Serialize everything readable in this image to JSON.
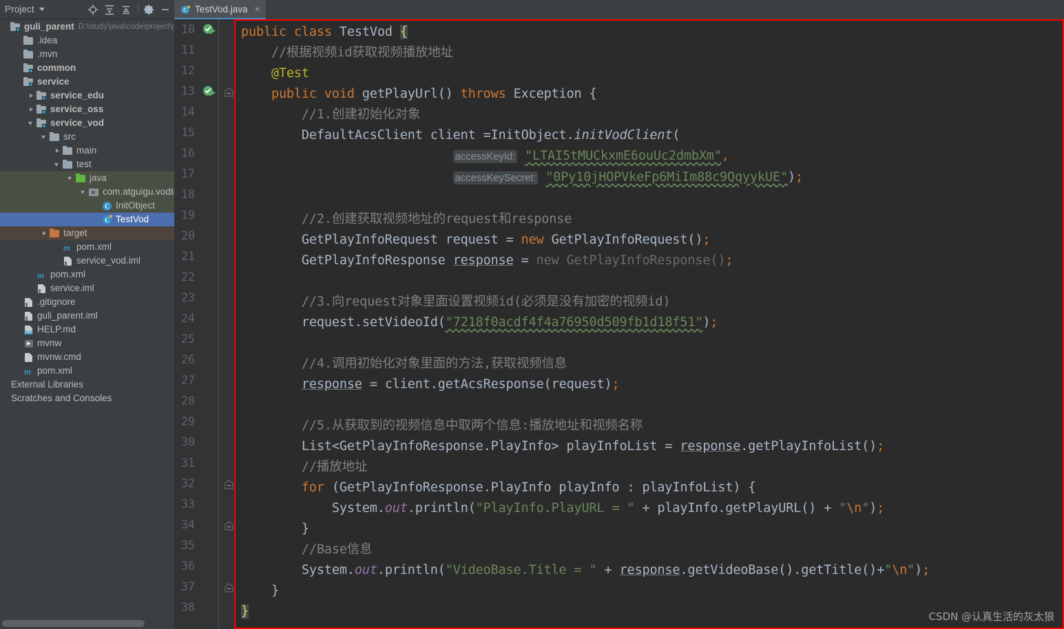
{
  "window": {
    "background": "#3c3f41",
    "editor_background": "#2b2b2b",
    "accent": "#4b6eaf",
    "highlight_border": "#ff0000"
  },
  "left_toolbar": {
    "title": "Project",
    "icons": [
      {
        "name": "locate-target-icon",
        "glyph": "locate"
      },
      {
        "name": "expand-all-icon",
        "glyph": "expand"
      },
      {
        "name": "collapse-all-icon",
        "glyph": "collapse"
      },
      {
        "name": "settings-gear-icon",
        "glyph": "gear"
      },
      {
        "name": "hide-panel-icon",
        "glyph": "minus"
      }
    ]
  },
  "tree": {
    "items": [
      {
        "label": "guli_parent",
        "path": "D:\\study\\java\\code\\project\\gu",
        "indent": 0,
        "arrow": "none",
        "icon": "module-icon",
        "bold": true,
        "state": "normal"
      },
      {
        "label": ".idea",
        "indent": 1,
        "arrow": "none",
        "icon": "folder-icon",
        "state": "normal"
      },
      {
        "label": ".mvn",
        "indent": 1,
        "arrow": "none",
        "icon": "folder-icon",
        "state": "normal"
      },
      {
        "label": "common",
        "indent": 1,
        "arrow": "none",
        "icon": "module-icon",
        "bold": true,
        "state": "normal"
      },
      {
        "label": "service",
        "indent": 1,
        "arrow": "none",
        "icon": "module-icon",
        "bold": true,
        "state": "normal"
      },
      {
        "label": "service_edu",
        "indent": 2,
        "arrow": "right",
        "icon": "module-icon",
        "bold": true,
        "state": "normal"
      },
      {
        "label": "service_oss",
        "indent": 2,
        "arrow": "right",
        "icon": "module-icon",
        "bold": true,
        "state": "normal"
      },
      {
        "label": "service_vod",
        "indent": 2,
        "arrow": "down",
        "icon": "module-icon",
        "bold": true,
        "state": "normal"
      },
      {
        "label": "src",
        "indent": 3,
        "arrow": "down",
        "icon": "folder-icon",
        "state": "normal"
      },
      {
        "label": "main",
        "indent": 4,
        "arrow": "right",
        "icon": "folder-icon",
        "state": "normal"
      },
      {
        "label": "test",
        "indent": 4,
        "arrow": "down",
        "icon": "folder-icon",
        "state": "normal"
      },
      {
        "label": "java",
        "indent": 5,
        "arrow": "down",
        "icon": "test-source-folder-icon",
        "state": "testsrc"
      },
      {
        "label": "com.atguigu.vodtest",
        "indent": 6,
        "arrow": "down",
        "icon": "package-icon",
        "state": "testsrc"
      },
      {
        "label": "InitObject",
        "indent": 7,
        "arrow": "none",
        "icon": "java-class-icon",
        "state": "testsrc"
      },
      {
        "label": "TestVod",
        "indent": 7,
        "arrow": "none",
        "icon": "java-test-class-icon",
        "state": "selected"
      },
      {
        "label": "target",
        "indent": 3,
        "arrow": "right",
        "icon": "excluded-folder-icon",
        "state": "target"
      },
      {
        "label": "pom.xml",
        "indent": 4,
        "arrow": "none",
        "icon": "maven-icon",
        "state": "normal"
      },
      {
        "label": "service_vod.iml",
        "indent": 4,
        "arrow": "none",
        "icon": "iml-file-icon",
        "state": "normal"
      },
      {
        "label": "pom.xml",
        "indent": 2,
        "arrow": "none",
        "icon": "maven-icon",
        "state": "normal"
      },
      {
        "label": "service.iml",
        "indent": 2,
        "arrow": "none",
        "icon": "iml-file-icon",
        "state": "normal"
      },
      {
        "label": ".gitignore",
        "indent": 1,
        "arrow": "none",
        "icon": "gitignore-file-icon",
        "state": "normal"
      },
      {
        "label": "guli_parent.iml",
        "indent": 1,
        "arrow": "none",
        "icon": "iml-file-icon",
        "state": "normal"
      },
      {
        "label": "HELP.md",
        "indent": 1,
        "arrow": "none",
        "icon": "markdown-file-icon",
        "state": "normal"
      },
      {
        "label": "mvnw",
        "indent": 1,
        "arrow": "none",
        "icon": "shell-script-icon",
        "state": "normal"
      },
      {
        "label": "mvnw.cmd",
        "indent": 1,
        "arrow": "none",
        "icon": "cmd-file-icon",
        "state": "normal"
      },
      {
        "label": "pom.xml",
        "indent": 1,
        "arrow": "none",
        "icon": "maven-icon",
        "state": "normal"
      },
      {
        "label": "External Libraries",
        "indent": 0,
        "arrow": "none",
        "icon": "library-icon",
        "state": "normal"
      },
      {
        "label": "Scratches and Consoles",
        "indent": 0,
        "arrow": "none",
        "icon": "scratches-icon",
        "state": "normal"
      }
    ]
  },
  "tabs": [
    {
      "label": "TestVod.java",
      "icon": "java-test-class-icon",
      "active": true,
      "close": "×"
    }
  ],
  "editor": {
    "first_line": 10,
    "last_line": 38,
    "line_numbers": [
      10,
      11,
      12,
      13,
      14,
      15,
      16,
      17,
      18,
      19,
      20,
      21,
      22,
      23,
      24,
      25,
      26,
      27,
      28,
      29,
      30,
      31,
      32,
      33,
      34,
      35,
      36,
      37,
      38
    ],
    "run_gutter_lines": [
      10,
      13
    ],
    "fold_gutter_lines": [
      13,
      32,
      34,
      37
    ],
    "hints": {
      "access_key_id": "accessKeyId:",
      "access_key_secret": "accessKeySecret:"
    },
    "values": {
      "class_name": "TestVod",
      "method_name": "getPlayUrl",
      "access_key_id": "LTAI5tMUCkxmE6ouUc2dmbXm",
      "access_key_secret": "0Py10jHOPVkeFp6MiIm88c9QqyykUE",
      "video_id": "7218f0acdf4f4a76950d509fb1d18f51",
      "print_playurl": "PlayInfo.PlayURL = ",
      "print_title": "VideoBase.Title = ",
      "newline": "\\n"
    },
    "comments": {
      "c0": "//根据视频id获取视频播放地址",
      "c1": "//1.创建初始化对象",
      "c2": "//2.创建获取视频地址的request和response",
      "c3": "//3.向request对象里面设置视频id(必须是没有加密的视频id)",
      "c4": "//4.调用初始化对象里面的方法,获取视频信息",
      "c5": "//5.从获取到的视频信息中取两个信息:播放地址和视频名称",
      "c6": "//播放地址",
      "c7": "//Base信息"
    },
    "code_lines": [
      "public class TestVod {",
      "    //根据视频id获取视频播放地址",
      "    @Test",
      "    public void getPlayUrl() throws Exception {",
      "        //1.创建初始化对象",
      "        DefaultAcsClient client =InitObject.initVodClient(",
      "                            accessKeyId: \"LTAI5tMUCkxmE6ouUc2dmbXm\",",
      "                            accessKeySecret: \"0Py10jHOPVkeFp6MiIm88c9QqyykUE\");",
      "",
      "        //2.创建获取视频地址的request和response",
      "        GetPlayInfoRequest request = new GetPlayInfoRequest();",
      "        GetPlayInfoResponse response = new GetPlayInfoResponse();",
      "",
      "        //3.向request对象里面设置视频id(必须是没有加密的视频id)",
      "        request.setVideoId(\"7218f0acdf4f4a76950d509fb1d18f51\");",
      "",
      "        //4.调用初始化对象里面的方法,获取视频信息",
      "        response = client.getAcsResponse(request);",
      "",
      "        //5.从获取到的视频信息中取两个信息:播放地址和视频名称",
      "        List<GetPlayInfoResponse.PlayInfo> playInfoList = response.getPlayInfoList();",
      "        //播放地址",
      "        for (GetPlayInfoResponse.PlayInfo playInfo : playInfoList) {",
      "            System.out.println(\"PlayInfo.PlayURL = \" + playInfo.getPlayURL() + \"\\n\");",
      "        }",
      "        //Base信息",
      "        System.out.println(\"VideoBase.Title = \" + response.getVideoBase().getTitle()+\"\\n\");",
      "    }",
      "}"
    ]
  },
  "watermark": {
    "text": "CSDN @认真生活的灰太狼"
  }
}
